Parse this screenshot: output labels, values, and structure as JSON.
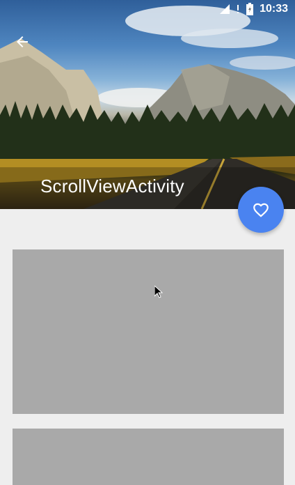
{
  "status_bar": {
    "time": "10:33",
    "icons": [
      "signal-icon",
      "no-sim-alert-icon",
      "battery-icon"
    ]
  },
  "toolbar": {
    "title": "ScrollViewActivity",
    "back_icon": "arrow-left-icon"
  },
  "fab": {
    "icon": "heart-outline-icon",
    "color": "#4a83f0"
  },
  "content": {
    "background": "#eeeeee",
    "card_color": "#a9a9a9",
    "cards": 2
  }
}
